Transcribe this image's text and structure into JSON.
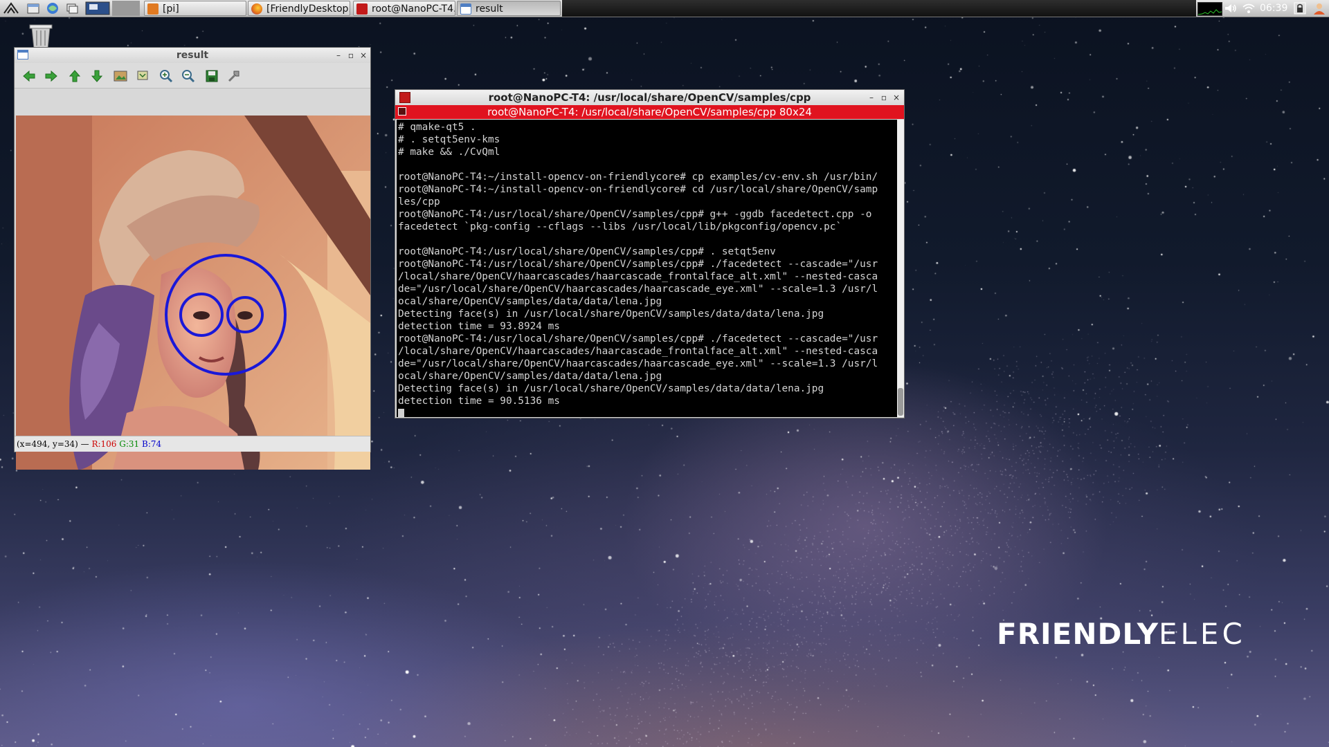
{
  "taskbar": {
    "tasks": [
      {
        "label": "[pi]",
        "icon": "folder-icon",
        "color": "#e07a22"
      },
      {
        "label": "[FriendlyDesktop...",
        "icon": "firefox-icon",
        "color": "#e06a1a"
      },
      {
        "label": "root@NanoPC-T4...",
        "icon": "terminal-icon",
        "color": "#c21a1a"
      },
      {
        "label": "result",
        "icon": "window-icon",
        "color": "#4f7fc4"
      }
    ],
    "clock": "06:39"
  },
  "result_window": {
    "title": "result",
    "tools": [
      "back-arrow-icon",
      "forward-arrow-icon",
      "up-arrow-icon",
      "down-arrow-icon",
      "image-icon",
      "zoom-fit-icon",
      "zoom-in-icon",
      "zoom-out-icon",
      "save-icon",
      "properties-icon"
    ],
    "status": {
      "coords": "(x=494, y=34) — ",
      "r": "R:106",
      "g": "G:31",
      "b": "B:74"
    }
  },
  "terminal": {
    "title": "root@NanoPC-T4: /usr/local/share/OpenCV/samples/cpp",
    "tab_label": "root@NanoPC-T4: /usr/local/share/OpenCV/samples/cpp 80x24",
    "lines": [
      "# qmake-qt5 .",
      "# . setqt5env-kms",
      "# make && ./CvQml",
      "",
      "root@NanoPC-T4:~/install-opencv-on-friendlycore# cp examples/cv-env.sh /usr/bin/",
      "root@NanoPC-T4:~/install-opencv-on-friendlycore# cd /usr/local/share/OpenCV/samp",
      "les/cpp",
      "root@NanoPC-T4:/usr/local/share/OpenCV/samples/cpp# g++ -ggdb facedetect.cpp -o",
      "facedetect `pkg-config --cflags --libs /usr/local/lib/pkgconfig/opencv.pc`",
      "",
      "root@NanoPC-T4:/usr/local/share/OpenCV/samples/cpp# . setqt5env",
      "root@NanoPC-T4:/usr/local/share/OpenCV/samples/cpp# ./facedetect --cascade=\"/usr",
      "/local/share/OpenCV/haarcascades/haarcascade_frontalface_alt.xml\" --nested-casca",
      "de=\"/usr/local/share/OpenCV/haarcascades/haarcascade_eye.xml\" --scale=1.3 /usr/l",
      "ocal/share/OpenCV/samples/data/data/lena.jpg",
      "Detecting face(s) in /usr/local/share/OpenCV/samples/data/data/lena.jpg",
      "detection time = 93.8924 ms",
      "root@NanoPC-T4:/usr/local/share/OpenCV/samples/cpp# ./facedetect --cascade=\"/usr",
      "/local/share/OpenCV/haarcascades/haarcascade_frontalface_alt.xml\" --nested-casca",
      "de=\"/usr/local/share/OpenCV/haarcascades/haarcascade_eye.xml\" --scale=1.3 /usr/l",
      "ocal/share/OpenCV/samples/data/data/lena.jpg",
      "Detecting face(s) in /usr/local/share/OpenCV/samples/data/data/lena.jpg",
      "detection time = 90.5136 ms"
    ]
  },
  "brand": {
    "part1": "FRIENDLY",
    "part2": "ELEC"
  },
  "colors": {
    "terminal_tab": "#e0131f",
    "detection_circle": "#1a18d8",
    "status_r": "#cc0000",
    "status_g": "#008800",
    "status_b": "#0000cc"
  }
}
